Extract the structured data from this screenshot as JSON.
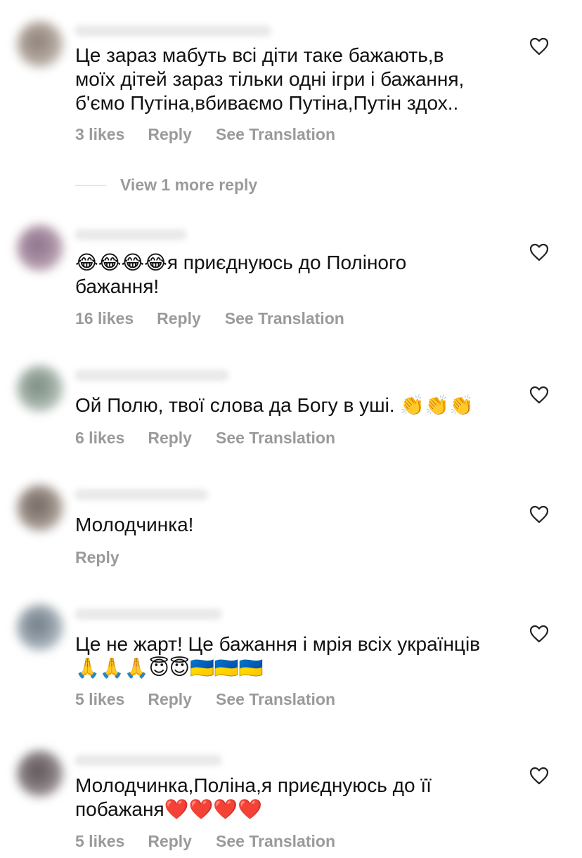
{
  "comments": [
    {
      "text": "Це зараз мабуть всі діти таке бажають,в\nмоїх дітей зараз тільки одні ігри і бажання,\nб'ємо Путіна,вбиваємо Путіна,Путін здох..",
      "likes": "3 likes",
      "reply": "Reply",
      "translate": "See Translation",
      "view_more": "View 1 more reply"
    },
    {
      "text": "😂😂😂😂я приєднуюсь до Поліного\nбажання!",
      "likes": "16 likes",
      "reply": "Reply",
      "translate": "See Translation"
    },
    {
      "text": "Ой Полю, твої слова да Богу в уші. 👏👏👏",
      "likes": "6 likes",
      "reply": "Reply",
      "translate": "See Translation"
    },
    {
      "text": "Молодчинка!",
      "reply": "Reply"
    },
    {
      "text": "Це не жарт! Це бажання і мрія всіх українців\n🙏🙏🙏😇😇🇺🇦🇺🇦🇺🇦",
      "likes": "5 likes",
      "reply": "Reply",
      "translate": "See Translation"
    },
    {
      "text": "Молодчинка,Поліна,я приєднуюсь до її\nпобажаня❤️❤️❤️❤️",
      "likes": "5 likes",
      "reply": "Reply",
      "translate": "See Translation"
    }
  ],
  "icons": {
    "like": "heart-icon"
  },
  "colors": {
    "text": "#111111",
    "meta": "#9a9a9a",
    "background": "#ffffff"
  }
}
